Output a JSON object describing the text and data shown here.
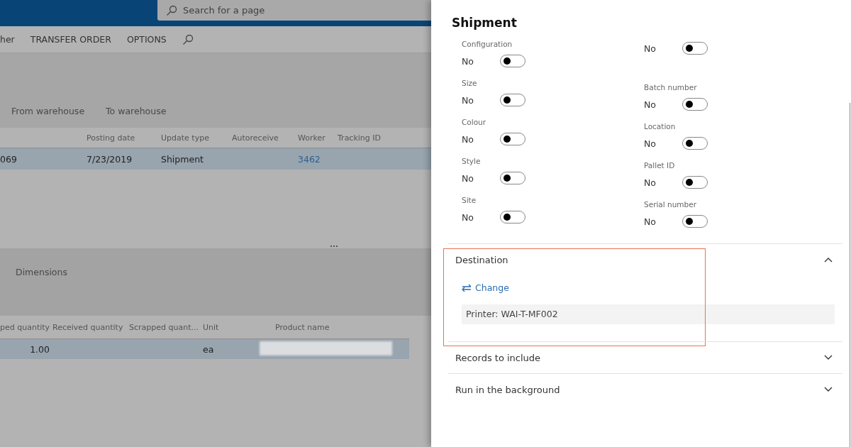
{
  "top_bar": {
    "search": {
      "placeholder": "Search for a page"
    }
  },
  "action_bar": {
    "items": [
      "her",
      "TRANSFER ORDER",
      "OPTIONS"
    ]
  },
  "header_tabs": [
    "From warehouse",
    "To warehouse"
  ],
  "journal_grid": {
    "columns": [
      "",
      "Posting date",
      "Update type",
      "Autoreceive",
      "Worker",
      "Tracking ID"
    ],
    "rows": [
      {
        "selected": true,
        "cells": [
          "069",
          "7/23/2019",
          "Shipment",
          "",
          "3462",
          ""
        ]
      }
    ]
  },
  "lines_section": {
    "tabs": [
      "Dimensions"
    ]
  },
  "lines_grid": {
    "columns": [
      "ped quantity",
      "Received quantity",
      "Scrapped quant...",
      "Unit",
      "Product name"
    ],
    "rows": [
      {
        "selected": true,
        "cells": [
          "1.00",
          "",
          "",
          "ea"
        ]
      }
    ]
  },
  "panel": {
    "title": "Shipment",
    "toggle_columns": [
      [
        {
          "label": "Configuration",
          "value": "No",
          "on": false
        },
        {
          "label": "Size",
          "value": "No",
          "on": false
        },
        {
          "label": "Colour",
          "value": "No",
          "on": false
        },
        {
          "label": "Style",
          "value": "No",
          "on": false
        },
        {
          "label": "Site",
          "value": "No",
          "on": false
        }
      ],
      [
        {
          "value": "No",
          "on": false
        },
        {
          "label": "Batch number",
          "value": "No",
          "on": false
        },
        {
          "label": "Location",
          "value": "No",
          "on": false
        },
        {
          "label": "Pallet ID",
          "value": "No",
          "on": false
        },
        {
          "label": "Serial number",
          "value": "No",
          "on": false
        }
      ]
    ],
    "sections": [
      {
        "title": "Destination",
        "expanded": true,
        "highlighted": true,
        "link": "Change",
        "field": "Printer: WAI-T-MF002"
      },
      {
        "title": "Records to include",
        "expanded": false,
        "highlighted": false
      },
      {
        "title": "Run in the background",
        "expanded": false,
        "highlighted": false
      }
    ]
  }
}
